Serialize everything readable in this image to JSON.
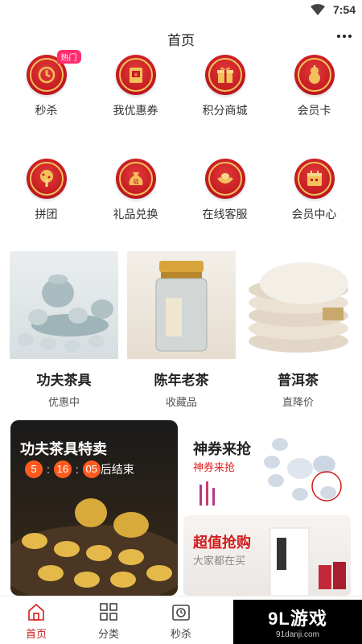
{
  "status_bar": {
    "time": "7:54"
  },
  "header": {
    "title": "首页"
  },
  "grid_row1": [
    {
      "label": "秒杀",
      "icon": "clock-icon",
      "badge": "热门"
    },
    {
      "label": "我优惠券",
      "icon": "coupon-icon"
    },
    {
      "label": "积分商城",
      "icon": "gift-box-icon"
    },
    {
      "label": "会员卡",
      "icon": "gourd-icon"
    }
  ],
  "grid_row2": [
    {
      "label": "拼团",
      "icon": "tree-icon"
    },
    {
      "label": "礼品兑换",
      "icon": "money-bag-icon"
    },
    {
      "label": "在线客服",
      "icon": "ingot-icon"
    },
    {
      "label": "会员中心",
      "icon": "calendar-icon"
    }
  ],
  "products": [
    {
      "name": "功夫茶具",
      "sub": "优惠中"
    },
    {
      "name": "陈年老茶",
      "sub": "收藏品"
    },
    {
      "name": "普洱茶",
      "sub": "直降价"
    }
  ],
  "promo_left": {
    "title": "功夫茶具特卖",
    "h": "5",
    "m": "16",
    "s": "05",
    "suffix": "后结束"
  },
  "promo_right_top": {
    "title": "神券来抢",
    "sub": "神券来抢"
  },
  "promo_right_bottom": {
    "title": "超值抢购",
    "sub": "大家都在买"
  },
  "tabbar": [
    {
      "label": "首页",
      "icon": "home-icon",
      "active": true
    },
    {
      "label": "分类",
      "icon": "grid-icon"
    },
    {
      "label": "秒杀",
      "icon": "timer-icon"
    }
  ],
  "watermark": {
    "brand": "9L游戏",
    "url": "91danji.com"
  },
  "colors": {
    "accent": "#d11c1c",
    "icon_bg": "#c61b22",
    "gold": "#f2c15a",
    "countdown": "#ff5a1f"
  }
}
